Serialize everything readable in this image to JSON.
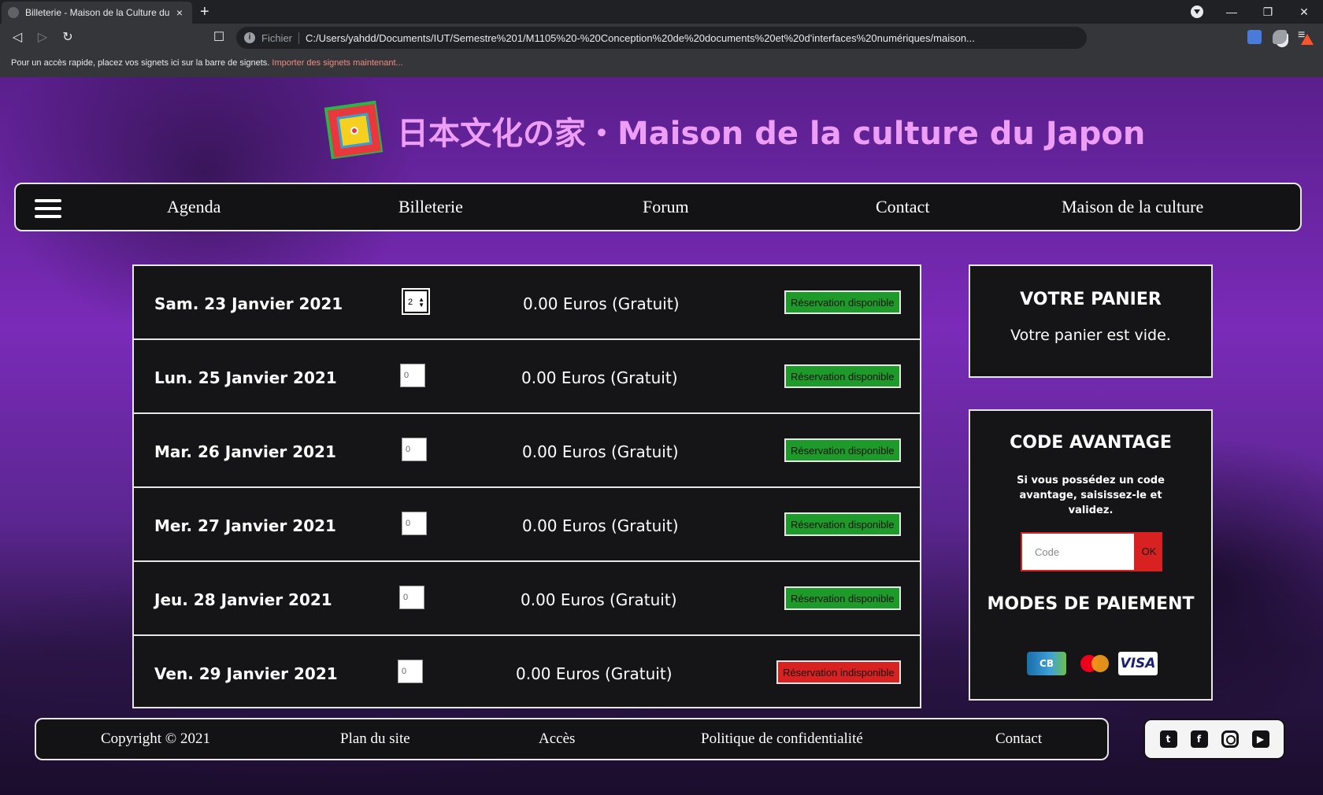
{
  "browser": {
    "tab_title": "Billeterie - Maison de la Culture du Japon",
    "tab_close": "×",
    "new_tab": "+",
    "window_controls": {
      "minimize": "—",
      "restore": "❐",
      "close": "✕"
    },
    "nav": {
      "back": "◁",
      "forward": "▷",
      "reload": "↻",
      "bookmark": "☐",
      "menu": "≡"
    },
    "address_scheme": "Fichier",
    "address_url": "C:/Users/yahdd/Documents/IUT/Semestre%201/M1105%20-%20Conception%20de%20documents%20et%20d'interfaces%20numériques/maison...",
    "bookmarks_message": "Pour un accès rapide, placez vos signets ici sur la barre de signets.",
    "bookmarks_link": "Importer des signets maintenant..."
  },
  "site": {
    "title": "日本文化の家・Maison de la culture du Japon",
    "title_color": "#ef9ef7"
  },
  "nav": {
    "items": [
      {
        "label": "Agenda"
      },
      {
        "label": "Billeterie"
      },
      {
        "label": "Forum"
      },
      {
        "label": "Contact"
      },
      {
        "label": "Maison de la culture"
      }
    ]
  },
  "tickets": [
    {
      "date": "Sam. 23 Janvier 2021",
      "quantity": "2",
      "price": "0.00 Euros (Gratuit)",
      "status": "Réservation disponible",
      "available": true
    },
    {
      "date": "Lun. 25 Janvier 2021",
      "quantity": "0",
      "price": "0.00 Euros (Gratuit)",
      "status": "Réservation disponible",
      "available": true
    },
    {
      "date": "Mar. 26 Janvier 2021",
      "quantity": "0",
      "price": "0.00 Euros (Gratuit)",
      "status": "Réservation disponible",
      "available": true
    },
    {
      "date": "Mer. 27 Janvier 2021",
      "quantity": "0",
      "price": "0.00 Euros (Gratuit)",
      "status": "Réservation disponible",
      "available": true
    },
    {
      "date": "Jeu. 28 Janvier 2021",
      "quantity": "0",
      "price": "0.00 Euros (Gratuit)",
      "status": "Réservation disponible",
      "available": true
    },
    {
      "date": "Ven. 29 Janvier 2021",
      "quantity": "0",
      "price": "0.00 Euros (Gratuit)",
      "status": "Réservation indisponible",
      "available": false
    }
  ],
  "cart": {
    "title": "VOTRE PANIER",
    "empty_message": "Votre panier est vide."
  },
  "promo": {
    "title": "CODE AVANTAGE",
    "hint": "Si vous possédez un code avantage, saisissez-le et validez.",
    "input_placeholder": "Code",
    "submit_label": "OK",
    "payment_title": "MODES DE PAIEMENT",
    "payment_methods": [
      "CB",
      "Mastercard",
      "VISA"
    ]
  },
  "footer": {
    "links": [
      {
        "label": "Copyright © 2021"
      },
      {
        "label": "Plan du site"
      },
      {
        "label": "Accès"
      },
      {
        "label": "Politique de confidentialité"
      },
      {
        "label": "Contact"
      }
    ],
    "social": [
      "twitter-icon",
      "facebook-icon",
      "instagram-icon",
      "youtube-icon"
    ]
  },
  "colors": {
    "available": "#1e9a2a",
    "unavailable": "#d82222",
    "panel_bg": "#151518"
  }
}
